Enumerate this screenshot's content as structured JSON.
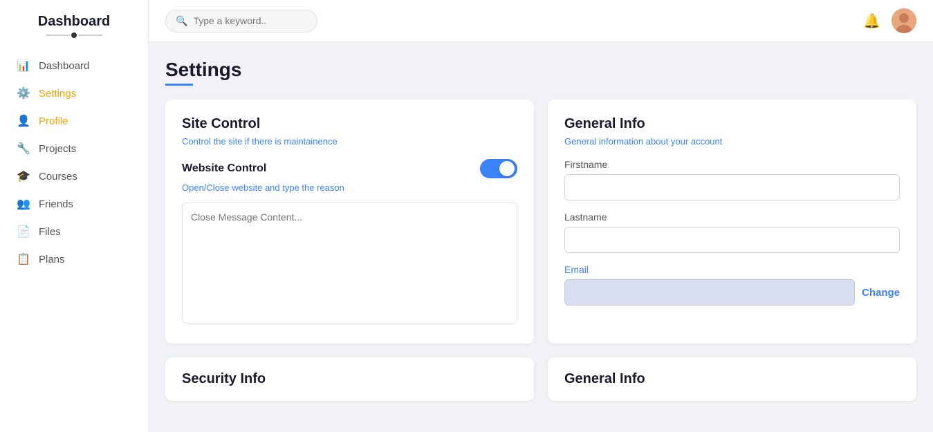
{
  "sidebar": {
    "logo": "Dashboard",
    "items": [
      {
        "id": "dashboard",
        "label": "Dashboard",
        "icon": "📊",
        "active": false
      },
      {
        "id": "settings",
        "label": "Settings",
        "icon": "⚙️",
        "active": true
      },
      {
        "id": "profile",
        "label": "Profile",
        "icon": "👤",
        "active": false
      },
      {
        "id": "projects",
        "label": "Projects",
        "icon": "🔧",
        "active": false
      },
      {
        "id": "courses",
        "label": "Courses",
        "icon": "🎓",
        "active": false
      },
      {
        "id": "friends",
        "label": "Friends",
        "icon": "👥",
        "active": false
      },
      {
        "id": "files",
        "label": "Files",
        "icon": "📄",
        "active": false
      },
      {
        "id": "plans",
        "label": "Plans",
        "icon": "📋",
        "active": false
      }
    ]
  },
  "header": {
    "search_placeholder": "Type a keyword.."
  },
  "page": {
    "title": "Settings"
  },
  "site_control": {
    "title": "Site Control",
    "subtitle_plain": "Control the ",
    "subtitle_link": "site if there is maintainence",
    "website_control_label": "Website Control",
    "website_control_desc": "Open/Close website and type the reason",
    "textarea_placeholder": "Close Message Content...",
    "toggle_on": true
  },
  "general_info": {
    "title": "General Info",
    "subtitle_plain": "General ",
    "subtitle_link": "information about your account",
    "firstname_label": "Firstname",
    "firstname_value": "",
    "lastname_label": "Lastname",
    "lastname_value": "",
    "email_label": "Email",
    "email_value": "",
    "change_label": "Change"
  },
  "bottom": {
    "security_title": "Security Info",
    "general2_title": "General Info"
  }
}
